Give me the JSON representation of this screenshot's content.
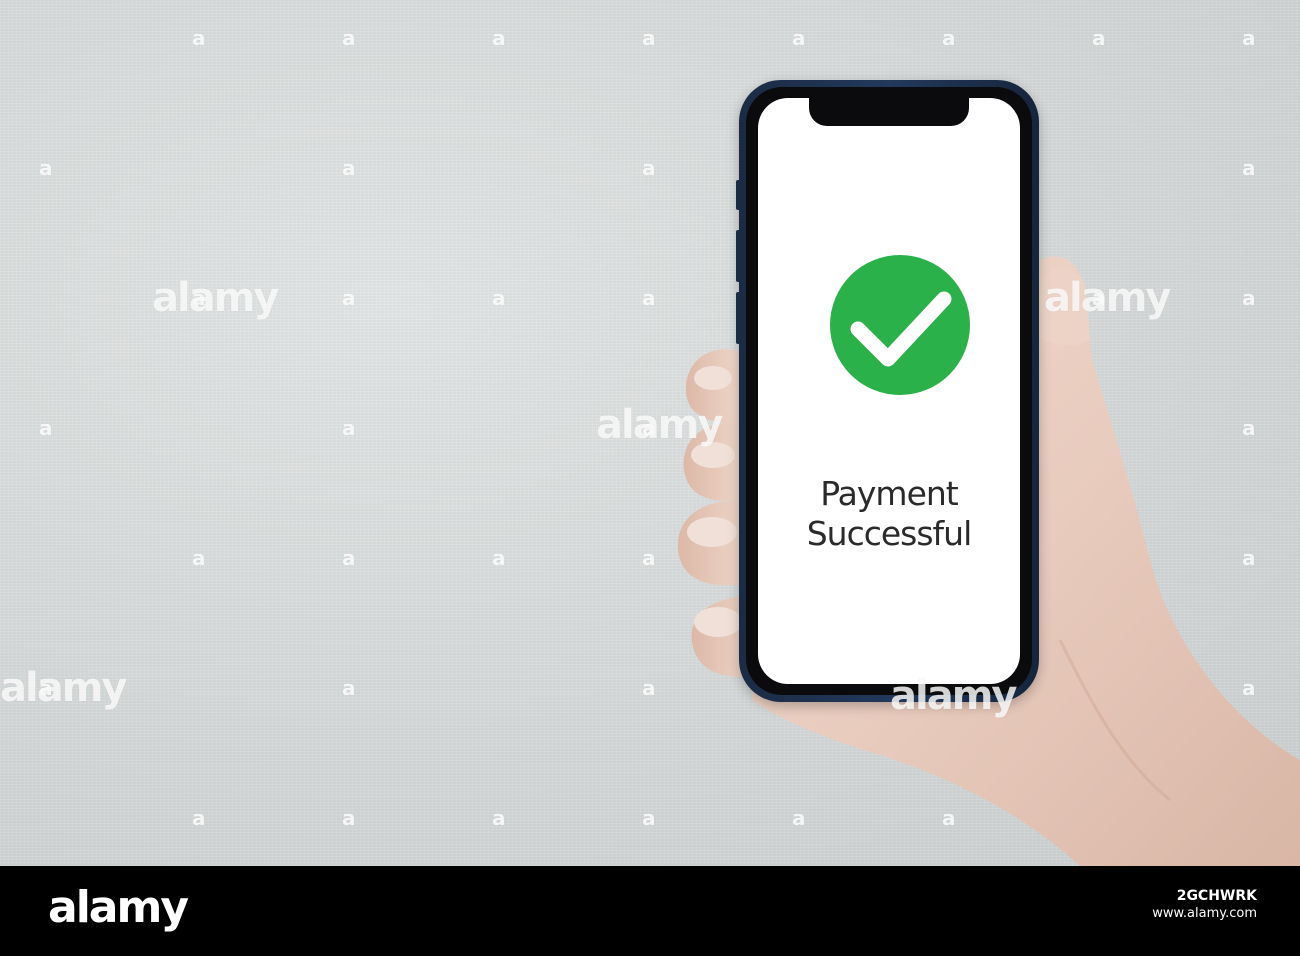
{
  "screen": {
    "status_line1": "Payment",
    "status_line2": "Successful",
    "icon": "check-circle-icon",
    "accent_color": "#2bb14a"
  },
  "watermark": {
    "word": "alamy",
    "glyph": "a"
  },
  "footer": {
    "logo": "alamy",
    "image_id": "2GCHWRK",
    "url": "www.alamy.com"
  }
}
